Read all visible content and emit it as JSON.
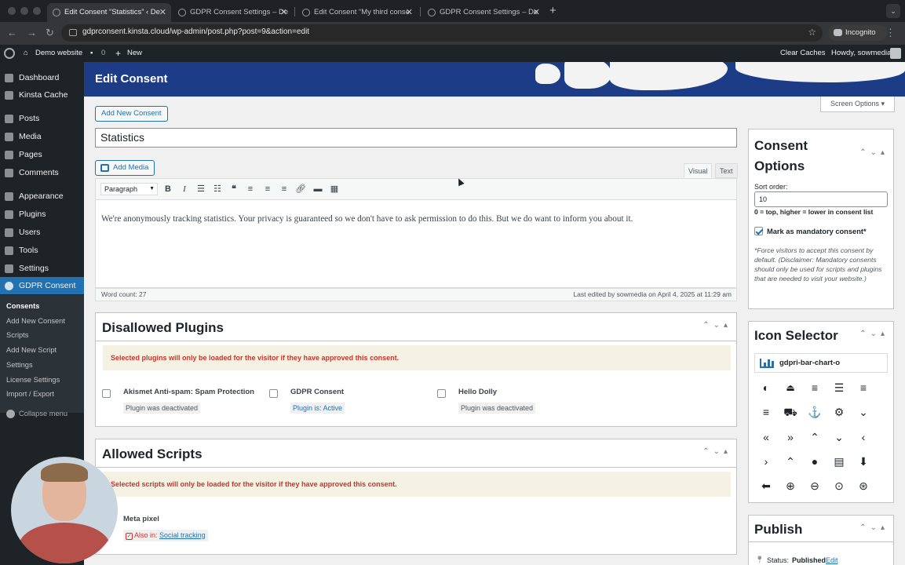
{
  "browser": {
    "tabs": [
      {
        "label": "Edit Consent “Statistics” ‹ De"
      },
      {
        "label": "GDPR Consent Settings – De"
      },
      {
        "label": "Edit Consent “My third conse"
      },
      {
        "label": "GDPR Consent Settings – De"
      }
    ],
    "url": "gdprconsent.kinsta.cloud/wp-admin/post.php?post=9&action=edit",
    "incognito_label": "Incognito"
  },
  "adminbar": {
    "site_name": "Demo website",
    "comments_count": "0",
    "new_label": "New",
    "clear_caches": "Clear Caches",
    "howdy": "Howdy, sowmedia"
  },
  "sidebar": {
    "items": [
      {
        "label": "Dashboard"
      },
      {
        "label": "Kinsta Cache"
      },
      {
        "label": "Posts"
      },
      {
        "label": "Media"
      },
      {
        "label": "Pages"
      },
      {
        "label": "Comments"
      },
      {
        "label": "Appearance"
      },
      {
        "label": "Plugins"
      },
      {
        "label": "Users"
      },
      {
        "label": "Tools"
      },
      {
        "label": "Settings"
      },
      {
        "label": "GDPR Consent"
      }
    ],
    "submenu": [
      {
        "label": "Consents"
      },
      {
        "label": "Add New Consent"
      },
      {
        "label": "Scripts"
      },
      {
        "label": "Add New Script"
      },
      {
        "label": "Settings"
      },
      {
        "label": "License Settings"
      },
      {
        "label": "Import / Export"
      }
    ],
    "collapse_label": "Collapse menu"
  },
  "page": {
    "title": "Edit Consent",
    "add_new_label": "Add New Consent",
    "screen_options": "Screen Options ▾",
    "post_title": "Statistics",
    "add_media": "Add Media",
    "tab_visual": "Visual",
    "tab_text": "Text",
    "format_select": "Paragraph",
    "content": "We're anonymously tracking statistics. Your privacy is guaranteed so we don't have to ask permission to do this. But we do want to inform you about it.",
    "word_count": "Word count: 27",
    "last_edited": "Last edited by sowmedia on April 4, 2025 at 11:29 am"
  },
  "disallowed": {
    "title": "Disallowed Plugins",
    "notice": "Selected plugins will only be loaded for the visitor if they have approved this consent.",
    "plugins": [
      {
        "name": "Akismet Anti-spam: Spam Protection",
        "status": "Plugin was deactivated"
      },
      {
        "name": "GDPR Consent",
        "status": "Plugin is: Active"
      },
      {
        "name": "Hello Dolly",
        "status": "Plugin was deactivated"
      }
    ]
  },
  "allowed": {
    "title": "Allowed Scripts",
    "notice": "Selected scripts will only be loaded for the visitor if they have approved this consent.",
    "script_name": "Meta pixel",
    "also_in_label": "Also in:",
    "also_in_link": "Social tracking"
  },
  "consent_options": {
    "title": "Consent Options",
    "sort_label": "Sort order:",
    "sort_value": "10",
    "sort_hint": "0 = top, higher = lower in consent list",
    "mandatory_label": "Mark as mandatory consent*",
    "mandatory_checked": true,
    "note": "*Force visitors to accept this consent by default. (Disclaimer: Mandatory consents should only be used for scripts and plugins that are needed to visit your website.)"
  },
  "icon_selector": {
    "title": "Icon Selector",
    "selected": "gdpri-bar-chart-o",
    "icons": [
      "adjust-icon",
      "eject-icon",
      "align-center-icon",
      "align-justify-icon",
      "align-left-icon",
      "align-right-icon",
      "ambulance-icon",
      "anchor-icon",
      "android-icon",
      "angle-double-down-icon",
      "angle-double-left-icon",
      "angle-double-right-icon",
      "angle-double-up-icon",
      "angle-down-icon",
      "angle-left-icon",
      "angle-right-icon",
      "angle-up-icon",
      "apple-icon",
      "archive-icon",
      "arrow-circle-down-icon",
      "arrow-circle-left-icon",
      "arrow-circle-o-down-icon",
      "arrow-circle-o-left-icon",
      "arrow-circle-o-right-icon",
      "arrow-circle-o-up-icon"
    ]
  },
  "publish": {
    "title": "Publish",
    "status_label": "Status:",
    "status_value": "Published",
    "edit_link": "Edit"
  }
}
